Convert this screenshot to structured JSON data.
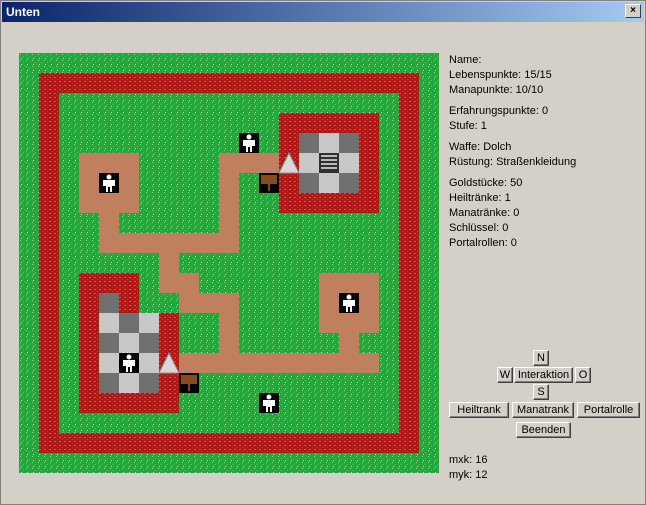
{
  "window": {
    "title": "Unten",
    "close_label": "×"
  },
  "stats": {
    "name": "Name:",
    "leben": "Lebenspunkte: 15/15",
    "mana": "Manapunkte: 10/10",
    "erfahrung": "Erfahrungspunkte: 0",
    "stufe": "Stufe: 1",
    "waffe": "Waffe: Dolch",
    "ruestung": "Rüstung: Straßenkleidung",
    "gold": "Goldstücke: 50",
    "heiltraenke": "Heiltränke: 1",
    "manatraenke": "Manatränke: 0",
    "schluessel": "Schlüssel: 0",
    "portalrollen": "Portalrollen: 0"
  },
  "controls": {
    "north": "N",
    "west": "W",
    "interaction": "Interaktion",
    "east": "O",
    "south": "S",
    "heiltrank": "Heiltrank",
    "manatrank": "Manatrank",
    "portalrolle": "Portalrolle",
    "beenden": "Beenden"
  },
  "coords": {
    "mxk": "mxk: 16",
    "myk": "myk: 12"
  },
  "colors": {
    "grass": "#22a83a",
    "wall": "#b01818",
    "path": "#c08060",
    "floor_light": "#c8c8c8",
    "floor_dark": "#707070"
  }
}
